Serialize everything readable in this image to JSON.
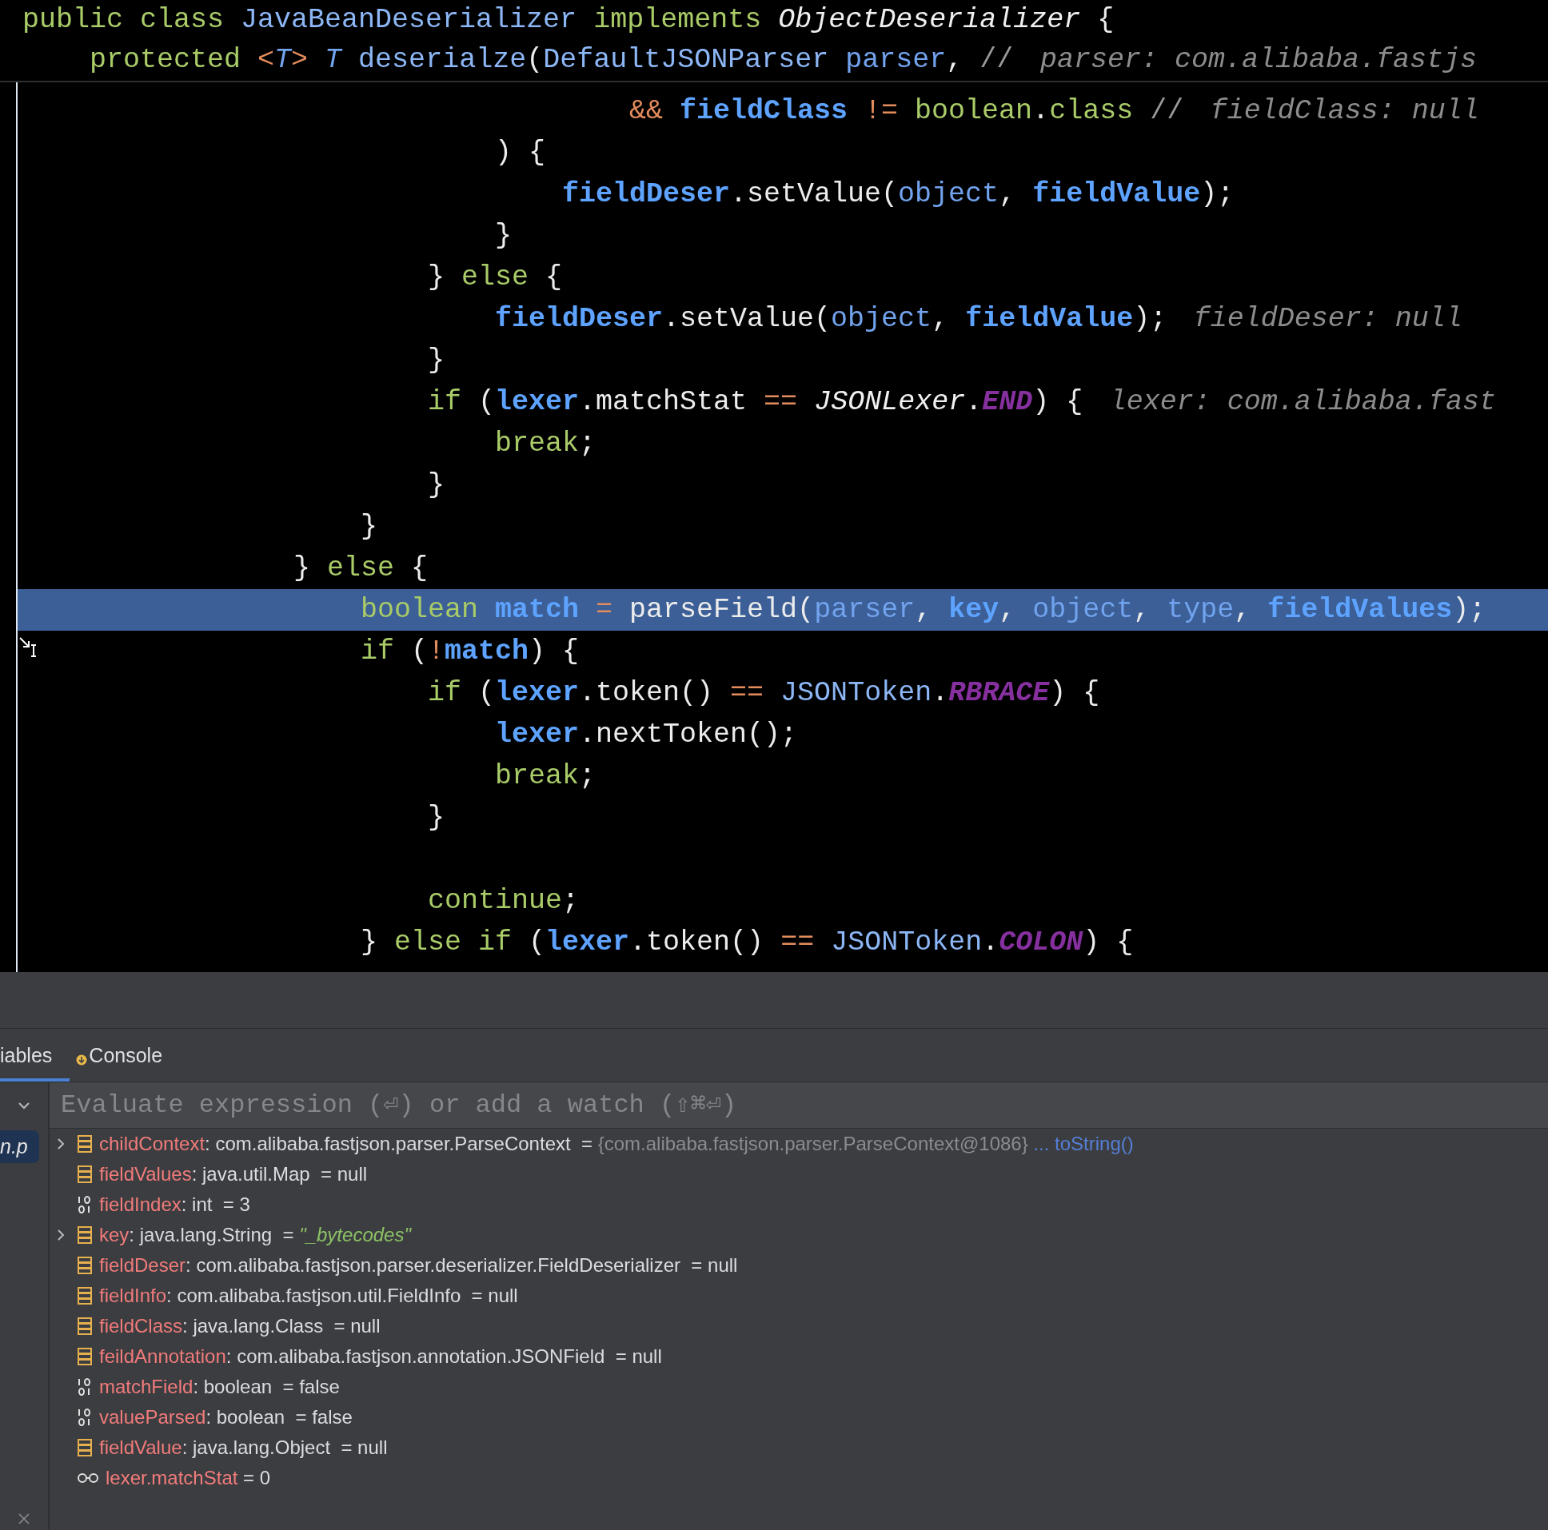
{
  "editor": {
    "sticky_header": [
      {
        "segments": [
          {
            "kind": "kw",
            "text": "public class "
          },
          {
            "kind": "cls",
            "text": "JavaBeanDeserializer"
          },
          {
            "kind": "kw",
            "text": " implements "
          },
          {
            "kind": "italic",
            "text": "ObjectDeserializer"
          },
          {
            "kind": "plain",
            "text": " {"
          }
        ]
      },
      {
        "segments": [
          {
            "kind": "kw",
            "text": "    protected "
          },
          {
            "kind": "op",
            "text": "<"
          },
          {
            "kind": "tparam",
            "text": "T"
          },
          {
            "kind": "op",
            "text": ">"
          },
          {
            "kind": "tparam",
            "text": " T"
          },
          {
            "kind": "cls",
            "text": " deserialze"
          },
          {
            "kind": "plain",
            "text": "("
          },
          {
            "kind": "cls",
            "text": "DefaultJSONParser"
          },
          {
            "kind": "param",
            "text": " parser"
          },
          {
            "kind": "plain",
            "text": ", "
          },
          {
            "kind": "comment",
            "text": "//"
          }
        ],
        "hint": "parser: com.alibaba.fastjs"
      }
    ],
    "lines": [
      {
        "current": false,
        "segments": [
          {
            "kind": "op",
            "text": "                                    && "
          },
          {
            "kind": "var",
            "text": "fieldClass"
          },
          {
            "kind": "op",
            "text": " != "
          },
          {
            "kind": "kw",
            "text": "boolean"
          },
          {
            "kind": "plain",
            "text": "."
          },
          {
            "kind": "kw",
            "text": "class"
          },
          {
            "kind": "comment",
            "text": " //"
          }
        ],
        "hint": "fieldClass: null"
      },
      {
        "current": false,
        "segments": [
          {
            "kind": "plain",
            "text": "                            ) {"
          }
        ]
      },
      {
        "current": false,
        "segments": [
          {
            "kind": "var",
            "text": "                                fieldDeser"
          },
          {
            "kind": "plain",
            "text": ".setValue("
          },
          {
            "kind": "param",
            "text": "object"
          },
          {
            "kind": "plain",
            "text": ", "
          },
          {
            "kind": "var",
            "text": "fieldValue"
          },
          {
            "kind": "plain",
            "text": ");"
          }
        ]
      },
      {
        "current": false,
        "segments": [
          {
            "kind": "plain",
            "text": "                            }"
          }
        ]
      },
      {
        "current": false,
        "segments": [
          {
            "kind": "plain",
            "text": "                        } "
          },
          {
            "kind": "kw",
            "text": "else"
          },
          {
            "kind": "plain",
            "text": " {"
          }
        ]
      },
      {
        "current": false,
        "segments": [
          {
            "kind": "var",
            "text": "                            fieldDeser"
          },
          {
            "kind": "plain",
            "text": ".setValue("
          },
          {
            "kind": "param",
            "text": "object"
          },
          {
            "kind": "plain",
            "text": ", "
          },
          {
            "kind": "var",
            "text": "fieldValue"
          },
          {
            "kind": "plain",
            "text": ");"
          }
        ],
        "hint": "fieldDeser: null"
      },
      {
        "current": false,
        "segments": [
          {
            "kind": "plain",
            "text": "                        }"
          }
        ]
      },
      {
        "current": false,
        "segments": [
          {
            "kind": "kw",
            "text": "                        if"
          },
          {
            "kind": "plain",
            "text": " ("
          },
          {
            "kind": "var",
            "text": "lexer"
          },
          {
            "kind": "plain",
            "text": ".matchStat "
          },
          {
            "kind": "op",
            "text": "=="
          },
          {
            "kind": "italic",
            "text": " JSONLexer"
          },
          {
            "kind": "plain",
            "text": "."
          },
          {
            "kind": "const",
            "text": "END"
          },
          {
            "kind": "plain",
            "text": ") {"
          }
        ],
        "hint": "lexer: com.alibaba.fast"
      },
      {
        "current": false,
        "segments": [
          {
            "kind": "kw",
            "text": "                            break"
          },
          {
            "kind": "plain",
            "text": ";"
          }
        ]
      },
      {
        "current": false,
        "segments": [
          {
            "kind": "plain",
            "text": "                        }"
          }
        ]
      },
      {
        "current": false,
        "segments": [
          {
            "kind": "plain",
            "text": "                    }"
          }
        ]
      },
      {
        "current": false,
        "segments": [
          {
            "kind": "plain",
            "text": "                } "
          },
          {
            "kind": "kw",
            "text": "else"
          },
          {
            "kind": "plain",
            "text": " {"
          }
        ]
      },
      {
        "current": true,
        "segments": [
          {
            "kind": "kw",
            "text": "                    boolean"
          },
          {
            "kind": "var",
            "text": " match"
          },
          {
            "kind": "op",
            "text": " = "
          },
          {
            "kind": "plain",
            "text": "parseField("
          },
          {
            "kind": "param",
            "text": "parser"
          },
          {
            "kind": "plain",
            "text": ", "
          },
          {
            "kind": "var",
            "text": "key"
          },
          {
            "kind": "plain",
            "text": ", "
          },
          {
            "kind": "param",
            "text": "object"
          },
          {
            "kind": "plain",
            "text": ", "
          },
          {
            "kind": "param",
            "text": "type"
          },
          {
            "kind": "plain",
            "text": ", "
          },
          {
            "kind": "var",
            "text": "fieldValues"
          },
          {
            "kind": "plain",
            "text": ");"
          }
        ]
      },
      {
        "current": false,
        "segments": [
          {
            "kind": "kw",
            "text": "                    if"
          },
          {
            "kind": "plain",
            "text": " ("
          },
          {
            "kind": "op",
            "text": "!"
          },
          {
            "kind": "var",
            "text": "match"
          },
          {
            "kind": "plain",
            "text": ") {"
          }
        ]
      },
      {
        "current": false,
        "segments": [
          {
            "kind": "kw",
            "text": "                        if"
          },
          {
            "kind": "plain",
            "text": " ("
          },
          {
            "kind": "var",
            "text": "lexer"
          },
          {
            "kind": "plain",
            "text": ".token() "
          },
          {
            "kind": "op",
            "text": "=="
          },
          {
            "kind": "cls",
            "text": " JSONToken"
          },
          {
            "kind": "plain",
            "text": "."
          },
          {
            "kind": "const",
            "text": "RBRACE"
          },
          {
            "kind": "plain",
            "text": ") {"
          }
        ]
      },
      {
        "current": false,
        "segments": [
          {
            "kind": "var",
            "text": "                            lexer"
          },
          {
            "kind": "plain",
            "text": ".nextToken();"
          }
        ]
      },
      {
        "current": false,
        "segments": [
          {
            "kind": "kw",
            "text": "                            break"
          },
          {
            "kind": "plain",
            "text": ";"
          }
        ]
      },
      {
        "current": false,
        "segments": [
          {
            "kind": "plain",
            "text": "                        }"
          }
        ]
      },
      {
        "current": false,
        "gap_before": true,
        "segments": [
          {
            "kind": "kw",
            "text": "                        continue"
          },
          {
            "kind": "plain",
            "text": ";"
          }
        ]
      },
      {
        "current": false,
        "segments": [
          {
            "kind": "plain",
            "text": "                    } "
          },
          {
            "kind": "kw",
            "text": "else"
          },
          {
            "kind": "kw",
            "text": " if"
          },
          {
            "kind": "plain",
            "text": " ("
          },
          {
            "kind": "var",
            "text": "lexer"
          },
          {
            "kind": "plain",
            "text": ".token() "
          },
          {
            "kind": "op",
            "text": "=="
          },
          {
            "kind": "cls",
            "text": " JSONToken"
          },
          {
            "kind": "plain",
            "text": "."
          },
          {
            "kind": "const",
            "text": "COLON"
          },
          {
            "kind": "plain",
            "text": ") {"
          }
        ]
      }
    ]
  },
  "debugger": {
    "tabs": [
      {
        "label": "iables",
        "selected": true
      },
      {
        "label": "Console",
        "selected": false,
        "badge": true
      }
    ],
    "frame": {
      "label": "n.p",
      "selected": true
    },
    "evaluate": {
      "placeholder": "Evaluate expression (⏎) or add a watch (⇧⌘⏎)"
    },
    "variables": [
      {
        "kind": "object",
        "expandable": true,
        "name": "childContext",
        "type": ": com.alibaba.fastjson.parser.ParseContext  =",
        "summary": "{com.alibaba.fastjson.parser.ParseContext@1086}",
        "link": "... toString()"
      },
      {
        "kind": "object",
        "expandable": false,
        "name": "fieldValues",
        "type": ": java.util.Map  =",
        "value": "null"
      },
      {
        "kind": "primitive",
        "expandable": false,
        "name": "fieldIndex",
        "type": ": int  =",
        "value": "3"
      },
      {
        "kind": "object",
        "expandable": true,
        "name": "key",
        "type": ": java.lang.String  =",
        "string": "\"_bytecodes\""
      },
      {
        "kind": "object",
        "expandable": false,
        "name": "fieldDeser",
        "type": ": com.alibaba.fastjson.parser.deserializer.FieldDeserializer  =",
        "value": "null"
      },
      {
        "kind": "object",
        "expandable": false,
        "name": "fieldInfo",
        "type": ": com.alibaba.fastjson.util.FieldInfo  =",
        "value": "null"
      },
      {
        "kind": "object",
        "expandable": false,
        "name": "fieldClass",
        "type": ": java.lang.Class  =",
        "value": "null"
      },
      {
        "kind": "object",
        "expandable": false,
        "name": "feildAnnotation",
        "type": ": com.alibaba.fastjson.annotation.JSONField  =",
        "value": "null"
      },
      {
        "kind": "primitive",
        "expandable": false,
        "name": "matchField",
        "type": ": boolean  =",
        "value": "false"
      },
      {
        "kind": "primitive",
        "expandable": false,
        "name": "valueParsed",
        "type": ": boolean  =",
        "value": "false"
      },
      {
        "kind": "object",
        "expandable": false,
        "name": "fieldValue",
        "type": ": java.lang.Object  =",
        "value": "null"
      },
      {
        "kind": "watch",
        "expandable": false,
        "name": "lexer.matchStat",
        "type": " =",
        "value": "0"
      }
    ]
  }
}
